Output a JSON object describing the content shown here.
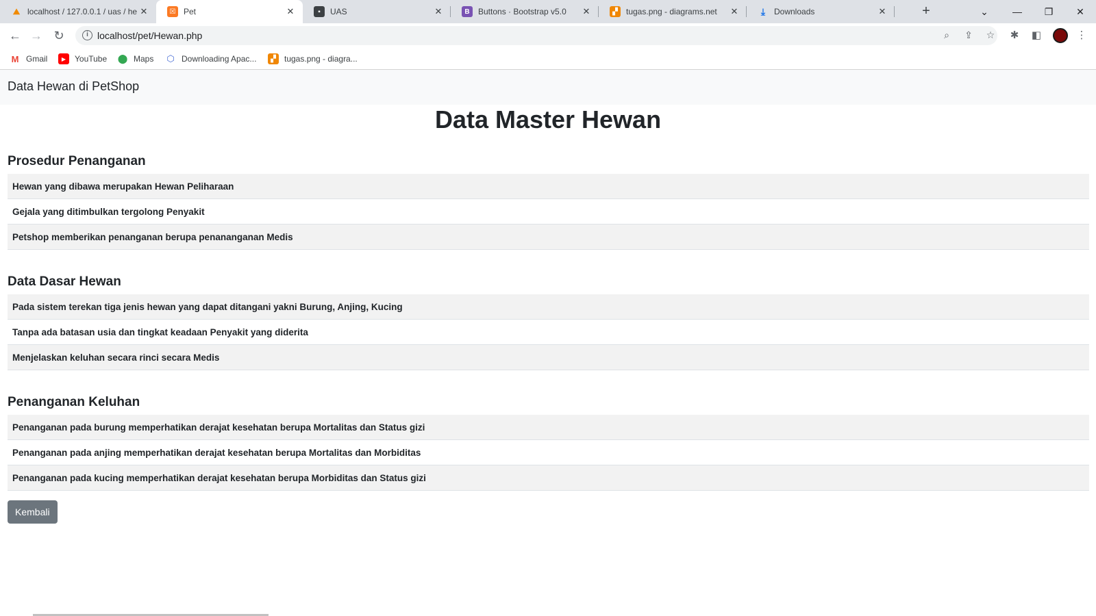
{
  "browser": {
    "tabs": [
      {
        "title": "localhost / 127.0.0.1 / uas / he",
        "icon": "phpmyadmin-icon",
        "active": false
      },
      {
        "title": "Pet",
        "icon": "xampp-icon",
        "active": true
      },
      {
        "title": "UAS",
        "icon": "terminal-icon",
        "active": false
      },
      {
        "title": "Buttons · Bootstrap v5.0",
        "icon": "bootstrap-icon",
        "active": false
      },
      {
        "title": "tugas.png - diagrams.net",
        "icon": "drawio-icon",
        "active": false
      },
      {
        "title": "Downloads",
        "icon": "download-icon",
        "active": false
      }
    ],
    "url": "localhost/pet/Hewan.php",
    "bookmarks": [
      {
        "label": "Gmail",
        "icon": "gmail-icon"
      },
      {
        "label": "YouTube",
        "icon": "youtube-icon"
      },
      {
        "label": "Maps",
        "icon": "maps-icon"
      },
      {
        "label": "Downloading Apac...",
        "icon": "apache-icon"
      },
      {
        "label": "tugas.png - diagra...",
        "icon": "drawio-icon"
      }
    ]
  },
  "page": {
    "navbar_brand": "Data Hewan di PetShop",
    "title": "Data Master Hewan",
    "sections": [
      {
        "heading": "Prosedur Penanganan",
        "rows": [
          "Hewan yang dibawa merupakan Hewan Peliharaan",
          "Gejala yang ditimbulkan tergolong Penyakit",
          "Petshop memberikan penanganan berupa penananganan Medis"
        ]
      },
      {
        "heading": "Data Dasar Hewan",
        "rows": [
          "Pada sistem terekan tiga jenis hewan yang dapat ditangani yakni Burung, Anjing, Kucing",
          "Tanpa ada batasan usia dan tingkat keadaan Penyakit yang diderita",
          "Menjelaskan keluhan secara rinci secara Medis"
        ]
      },
      {
        "heading": "Penanganan Keluhan",
        "rows": [
          "Penanganan pada burung memperhatikan derajat kesehatan berupa Mortalitas dan Status gizi",
          "Penanganan pada anjing memperhatikan derajat kesehatan berupa Mortalitas dan Morbiditas",
          "Penanganan pada kucing memperhatikan derajat kesehatan berupa Morbiditas dan Status gizi"
        ]
      }
    ],
    "back_button": "Kembali"
  },
  "colors": {
    "navbar_bg": "#f8f9fa",
    "stripe_bg": "#f2f2f2",
    "secondary_button": "#6c757d",
    "tabstrip_bg": "#dee1e6"
  }
}
